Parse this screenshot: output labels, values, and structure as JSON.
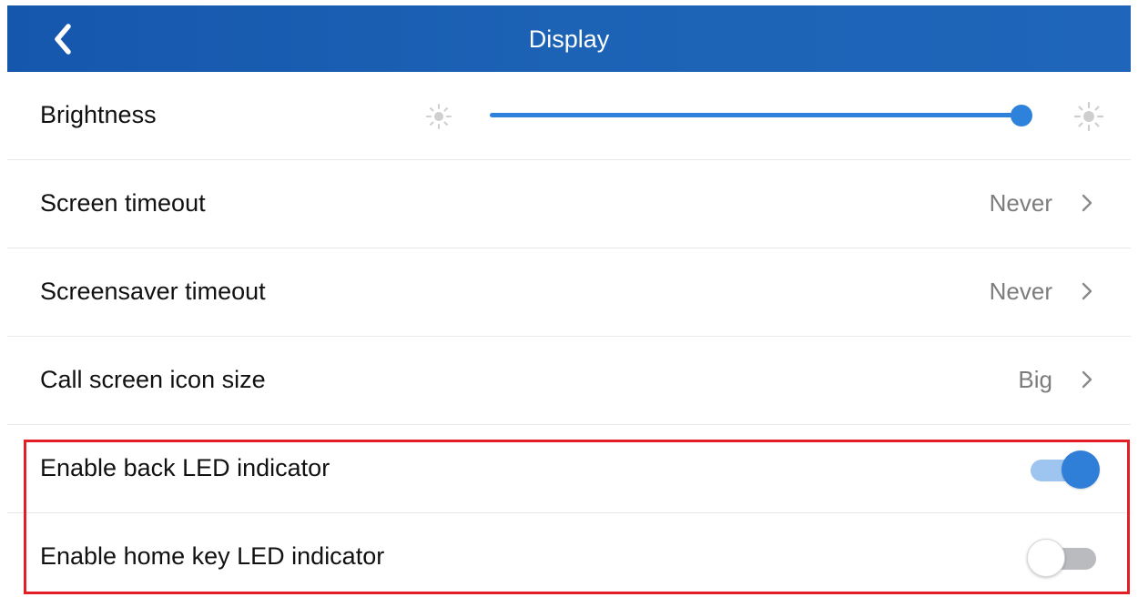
{
  "header": {
    "title": "Display",
    "back_icon": "chevron-left-icon",
    "background_color": "#1c62b5"
  },
  "brightness": {
    "label": "Brightness",
    "min_icon": "brightness-low-icon",
    "max_icon": "brightness-high-icon",
    "level_fraction": 1.0,
    "accent_color": "#2f82dc"
  },
  "settings": {
    "screen_timeout": {
      "label": "Screen timeout",
      "value": "Never"
    },
    "screensaver_timeout": {
      "label": "Screensaver timeout",
      "value": "Never"
    },
    "call_screen_icon_size": {
      "label": "Call screen icon size",
      "value": "Big"
    },
    "back_led": {
      "label": "Enable back LED indicator",
      "enabled": true
    },
    "home_key_led": {
      "label": "Enable home key LED indicator",
      "enabled": false
    }
  },
  "colors": {
    "highlight_border": "#e21f26",
    "toggle_on": "#2f7fd9"
  }
}
